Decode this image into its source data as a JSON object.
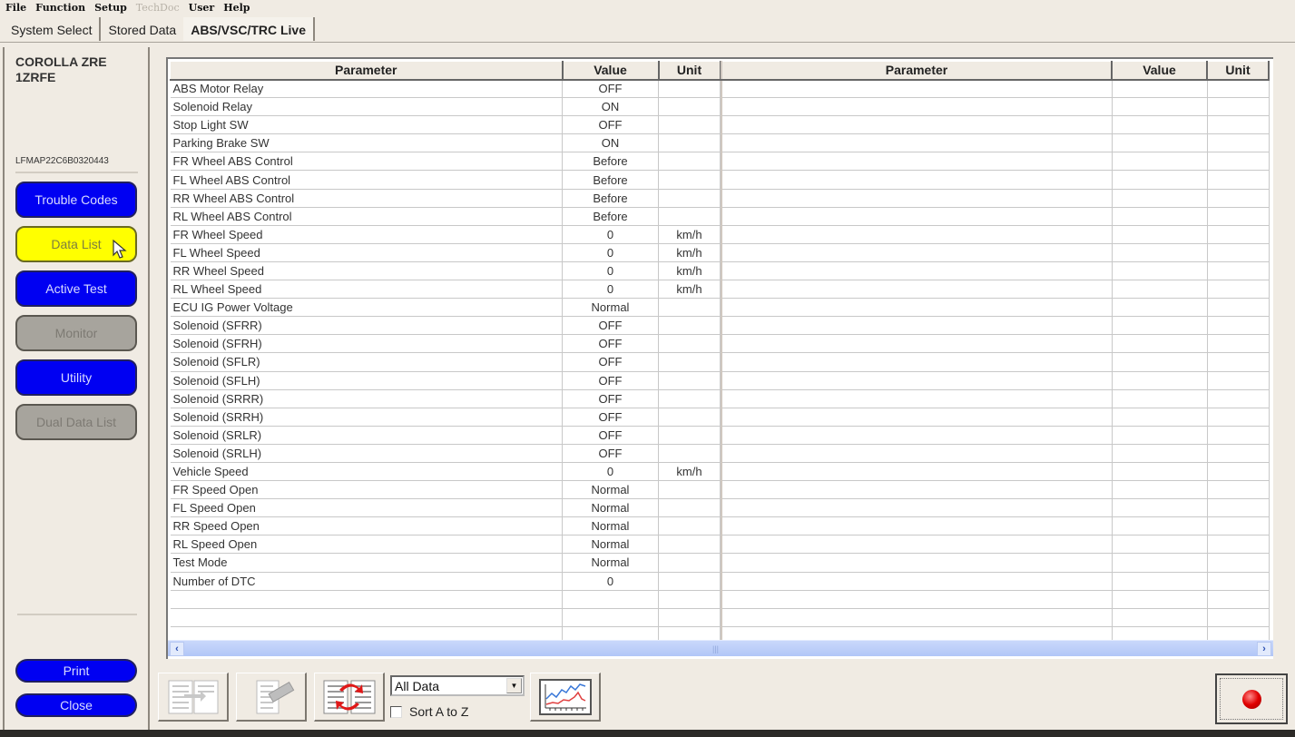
{
  "menu": {
    "items": [
      {
        "label": "File",
        "disabled": false
      },
      {
        "label": "Function",
        "disabled": false
      },
      {
        "label": "Setup",
        "disabled": false
      },
      {
        "label": "TechDoc",
        "disabled": true
      },
      {
        "label": "User",
        "disabled": false
      },
      {
        "label": "Help",
        "disabled": false
      }
    ]
  },
  "tabs": [
    {
      "label": "System Select",
      "active": false
    },
    {
      "label": "Stored Data",
      "active": false
    },
    {
      "label": "ABS/VSC/TRC Live",
      "active": true
    }
  ],
  "sidebar": {
    "vehicle_line1": "COROLLA ZRE",
    "vehicle_line2": "1ZRFE",
    "vin": "LFMAP22C6B0320443",
    "buttons": [
      {
        "label": "Trouble Codes",
        "state": "enabled"
      },
      {
        "label": "Data List",
        "state": "selected"
      },
      {
        "label": "Active Test",
        "state": "enabled"
      },
      {
        "label": "Monitor",
        "state": "disabled"
      },
      {
        "label": "Utility",
        "state": "enabled"
      },
      {
        "label": "Dual Data List",
        "state": "disabled"
      }
    ],
    "print_label": "Print",
    "close_label": "Close"
  },
  "grid": {
    "headers": {
      "parameter": "Parameter",
      "value": "Value",
      "unit": "Unit"
    },
    "rows": [
      {
        "parameter": "ABS Motor Relay",
        "value": "OFF",
        "unit": ""
      },
      {
        "parameter": "Solenoid Relay",
        "value": "ON",
        "unit": ""
      },
      {
        "parameter": "Stop Light SW",
        "value": "OFF",
        "unit": ""
      },
      {
        "parameter": "Parking Brake SW",
        "value": "ON",
        "unit": ""
      },
      {
        "parameter": "FR Wheel ABS Control",
        "value": "Before",
        "unit": ""
      },
      {
        "parameter": "FL Wheel ABS Control",
        "value": "Before",
        "unit": ""
      },
      {
        "parameter": "RR Wheel ABS Control",
        "value": "Before",
        "unit": ""
      },
      {
        "parameter": "RL Wheel ABS Control",
        "value": "Before",
        "unit": ""
      },
      {
        "parameter": "FR Wheel Speed",
        "value": "0",
        "unit": "km/h"
      },
      {
        "parameter": "FL Wheel Speed",
        "value": "0",
        "unit": "km/h"
      },
      {
        "parameter": "RR Wheel Speed",
        "value": "0",
        "unit": "km/h"
      },
      {
        "parameter": "RL Wheel Speed",
        "value": "0",
        "unit": "km/h"
      },
      {
        "parameter": "ECU IG Power Voltage",
        "value": "Normal",
        "unit": ""
      },
      {
        "parameter": "Solenoid (SFRR)",
        "value": "OFF",
        "unit": ""
      },
      {
        "parameter": "Solenoid (SFRH)",
        "value": "OFF",
        "unit": ""
      },
      {
        "parameter": "Solenoid (SFLR)",
        "value": "OFF",
        "unit": ""
      },
      {
        "parameter": "Solenoid (SFLH)",
        "value": "OFF",
        "unit": ""
      },
      {
        "parameter": "Solenoid (SRRR)",
        "value": "OFF",
        "unit": ""
      },
      {
        "parameter": "Solenoid (SRRH)",
        "value": "OFF",
        "unit": ""
      },
      {
        "parameter": "Solenoid (SRLR)",
        "value": "OFF",
        "unit": ""
      },
      {
        "parameter": "Solenoid (SRLH)",
        "value": "OFF",
        "unit": ""
      },
      {
        "parameter": "Vehicle Speed",
        "value": "0",
        "unit": "km/h"
      },
      {
        "parameter": "FR Speed Open",
        "value": "Normal",
        "unit": ""
      },
      {
        "parameter": "FL Speed Open",
        "value": "Normal",
        "unit": ""
      },
      {
        "parameter": "RR Speed Open",
        "value": "Normal",
        "unit": ""
      },
      {
        "parameter": "RL Speed Open",
        "value": "Normal",
        "unit": ""
      },
      {
        "parameter": "Test Mode",
        "value": "Normal",
        "unit": ""
      },
      {
        "parameter": "Number of DTC",
        "value": "0",
        "unit": ""
      },
      {
        "parameter": "",
        "value": "",
        "unit": ""
      },
      {
        "parameter": "",
        "value": "",
        "unit": ""
      },
      {
        "parameter": "",
        "value": "",
        "unit": ""
      }
    ]
  },
  "toolbar": {
    "filter_selected": "All Data",
    "sort_label": "Sort A to Z",
    "sort_checked": false,
    "icons": [
      "split-list-icon",
      "edit-list-icon",
      "swap-list-icon",
      "graph-icon",
      "record-icon"
    ]
  },
  "colors": {
    "button_blue": "#0000f2",
    "button_selected": "#ffff00",
    "button_disabled": "#a7a49d",
    "record_red": "#e00000"
  }
}
